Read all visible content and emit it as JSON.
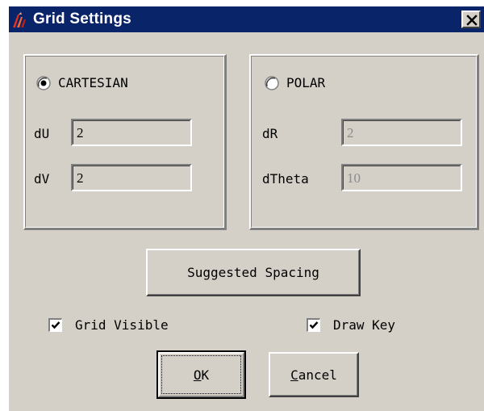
{
  "window": {
    "title": "Grid Settings",
    "app_icon": "app-logo-icon",
    "close_icon": "close-icon"
  },
  "cartesian": {
    "label": "CARTESIAN",
    "selected": true,
    "du_label": "dU",
    "du_value": "2",
    "dv_label": "dV",
    "dv_value": "2"
  },
  "polar": {
    "label": "POLAR",
    "selected": false,
    "dr_label": "dR",
    "dr_value": "2",
    "dtheta_label": "dTheta",
    "dtheta_value": "10"
  },
  "buttons": {
    "suggested_spacing": "Suggested Spacing",
    "ok_mnemonic": "O",
    "ok_rest": "K",
    "cancel_mnemonic": "C",
    "cancel_rest": "ancel"
  },
  "options": {
    "grid_visible_label": "Grid Visible",
    "grid_visible_checked": true,
    "draw_key_label": "Draw Key",
    "draw_key_checked": true
  },
  "colors": {
    "title_bar": "#0a246a",
    "dialog_face": "#d4d0c8",
    "disabled_text": "#8a8a8a"
  }
}
